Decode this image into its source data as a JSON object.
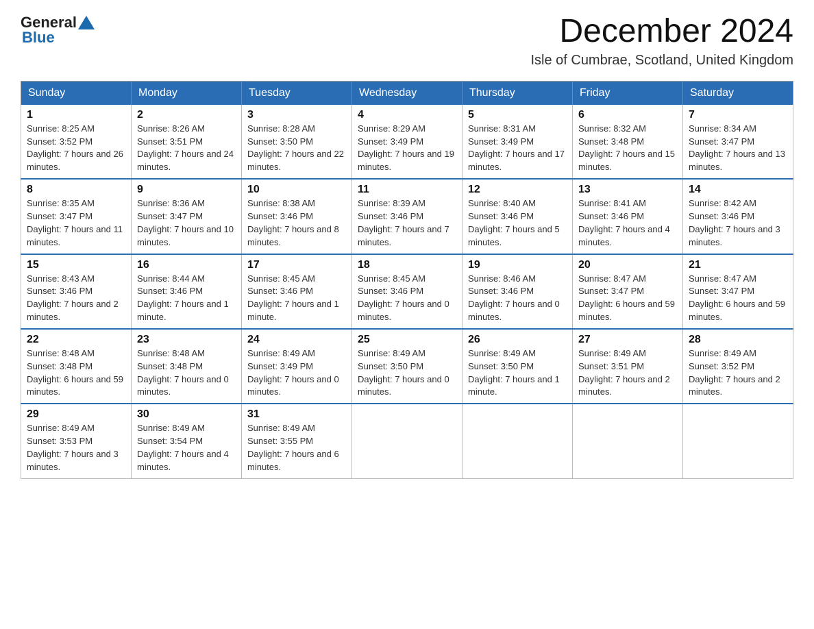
{
  "header": {
    "logo_general": "General",
    "logo_blue": "Blue",
    "month_title": "December 2024",
    "location": "Isle of Cumbrae, Scotland, United Kingdom"
  },
  "days_of_week": [
    "Sunday",
    "Monday",
    "Tuesday",
    "Wednesday",
    "Thursday",
    "Friday",
    "Saturday"
  ],
  "weeks": [
    [
      {
        "day": "1",
        "sunrise": "8:25 AM",
        "sunset": "3:52 PM",
        "daylight": "7 hours and 26 minutes."
      },
      {
        "day": "2",
        "sunrise": "8:26 AM",
        "sunset": "3:51 PM",
        "daylight": "7 hours and 24 minutes."
      },
      {
        "day": "3",
        "sunrise": "8:28 AM",
        "sunset": "3:50 PM",
        "daylight": "7 hours and 22 minutes."
      },
      {
        "day": "4",
        "sunrise": "8:29 AM",
        "sunset": "3:49 PM",
        "daylight": "7 hours and 19 minutes."
      },
      {
        "day": "5",
        "sunrise": "8:31 AM",
        "sunset": "3:49 PM",
        "daylight": "7 hours and 17 minutes."
      },
      {
        "day": "6",
        "sunrise": "8:32 AM",
        "sunset": "3:48 PM",
        "daylight": "7 hours and 15 minutes."
      },
      {
        "day": "7",
        "sunrise": "8:34 AM",
        "sunset": "3:47 PM",
        "daylight": "7 hours and 13 minutes."
      }
    ],
    [
      {
        "day": "8",
        "sunrise": "8:35 AM",
        "sunset": "3:47 PM",
        "daylight": "7 hours and 11 minutes."
      },
      {
        "day": "9",
        "sunrise": "8:36 AM",
        "sunset": "3:47 PM",
        "daylight": "7 hours and 10 minutes."
      },
      {
        "day": "10",
        "sunrise": "8:38 AM",
        "sunset": "3:46 PM",
        "daylight": "7 hours and 8 minutes."
      },
      {
        "day": "11",
        "sunrise": "8:39 AM",
        "sunset": "3:46 PM",
        "daylight": "7 hours and 7 minutes."
      },
      {
        "day": "12",
        "sunrise": "8:40 AM",
        "sunset": "3:46 PM",
        "daylight": "7 hours and 5 minutes."
      },
      {
        "day": "13",
        "sunrise": "8:41 AM",
        "sunset": "3:46 PM",
        "daylight": "7 hours and 4 minutes."
      },
      {
        "day": "14",
        "sunrise": "8:42 AM",
        "sunset": "3:46 PM",
        "daylight": "7 hours and 3 minutes."
      }
    ],
    [
      {
        "day": "15",
        "sunrise": "8:43 AM",
        "sunset": "3:46 PM",
        "daylight": "7 hours and 2 minutes."
      },
      {
        "day": "16",
        "sunrise": "8:44 AM",
        "sunset": "3:46 PM",
        "daylight": "7 hours and 1 minute."
      },
      {
        "day": "17",
        "sunrise": "8:45 AM",
        "sunset": "3:46 PM",
        "daylight": "7 hours and 1 minute."
      },
      {
        "day": "18",
        "sunrise": "8:45 AM",
        "sunset": "3:46 PM",
        "daylight": "7 hours and 0 minutes."
      },
      {
        "day": "19",
        "sunrise": "8:46 AM",
        "sunset": "3:46 PM",
        "daylight": "7 hours and 0 minutes."
      },
      {
        "day": "20",
        "sunrise": "8:47 AM",
        "sunset": "3:47 PM",
        "daylight": "6 hours and 59 minutes."
      },
      {
        "day": "21",
        "sunrise": "8:47 AM",
        "sunset": "3:47 PM",
        "daylight": "6 hours and 59 minutes."
      }
    ],
    [
      {
        "day": "22",
        "sunrise": "8:48 AM",
        "sunset": "3:48 PM",
        "daylight": "6 hours and 59 minutes."
      },
      {
        "day": "23",
        "sunrise": "8:48 AM",
        "sunset": "3:48 PM",
        "daylight": "7 hours and 0 minutes."
      },
      {
        "day": "24",
        "sunrise": "8:49 AM",
        "sunset": "3:49 PM",
        "daylight": "7 hours and 0 minutes."
      },
      {
        "day": "25",
        "sunrise": "8:49 AM",
        "sunset": "3:50 PM",
        "daylight": "7 hours and 0 minutes."
      },
      {
        "day": "26",
        "sunrise": "8:49 AM",
        "sunset": "3:50 PM",
        "daylight": "7 hours and 1 minute."
      },
      {
        "day": "27",
        "sunrise": "8:49 AM",
        "sunset": "3:51 PM",
        "daylight": "7 hours and 2 minutes."
      },
      {
        "day": "28",
        "sunrise": "8:49 AM",
        "sunset": "3:52 PM",
        "daylight": "7 hours and 2 minutes."
      }
    ],
    [
      {
        "day": "29",
        "sunrise": "8:49 AM",
        "sunset": "3:53 PM",
        "daylight": "7 hours and 3 minutes."
      },
      {
        "day": "30",
        "sunrise": "8:49 AM",
        "sunset": "3:54 PM",
        "daylight": "7 hours and 4 minutes."
      },
      {
        "day": "31",
        "sunrise": "8:49 AM",
        "sunset": "3:55 PM",
        "daylight": "7 hours and 6 minutes."
      },
      null,
      null,
      null,
      null
    ]
  ],
  "labels": {
    "sunrise_prefix": "Sunrise: ",
    "sunset_prefix": "Sunset: ",
    "daylight_prefix": "Daylight: "
  }
}
